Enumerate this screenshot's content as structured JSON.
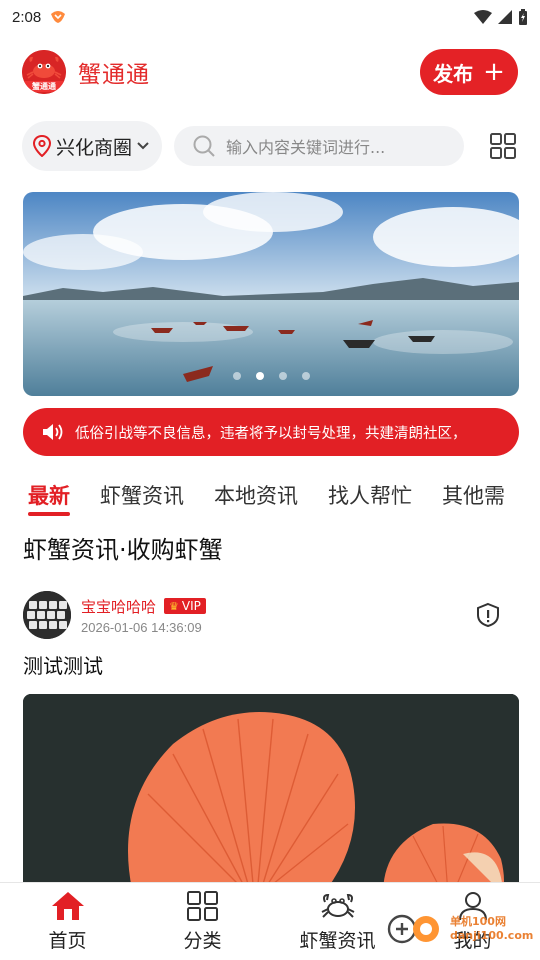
{
  "status_bar": {
    "time": "2:08"
  },
  "header": {
    "app_name": "蟹通通",
    "logo_text": "蟹通通",
    "publish_label": "发布",
    "accent_color": "#e22025"
  },
  "search": {
    "location": "兴化商圈",
    "placeholder": "输入内容关键词进行..."
  },
  "banner": {
    "slide_count": 4,
    "active_slide": 2
  },
  "notice": {
    "text": "低俗引战等不良信息，违者将予以封号处理，共建清朗社区，"
  },
  "tabs": [
    {
      "label": "最新",
      "active": true
    },
    {
      "label": "虾蟹资讯",
      "active": false
    },
    {
      "label": "本地资讯",
      "active": false
    },
    {
      "label": "找人帮忙",
      "active": false
    },
    {
      "label": "其他需",
      "active": false
    }
  ],
  "section": {
    "title": "虾蟹资讯·收购虾蟹"
  },
  "post": {
    "author": "宝宝哈哈哈",
    "badge": "VIP",
    "time": "2026-01-06 14:36:09",
    "text": "测试测试"
  },
  "bottom_nav": [
    {
      "label": "首页",
      "icon": "home-icon",
      "active": true
    },
    {
      "label": "分类",
      "icon": "category-grid-icon",
      "active": false
    },
    {
      "label": "虾蟹资讯",
      "icon": "crab-icon",
      "active": false
    },
    {
      "label": "我的",
      "icon": "profile-icon",
      "active": false
    }
  ],
  "watermark": {
    "line1": "单机100网",
    "line2": "danji100.com"
  }
}
